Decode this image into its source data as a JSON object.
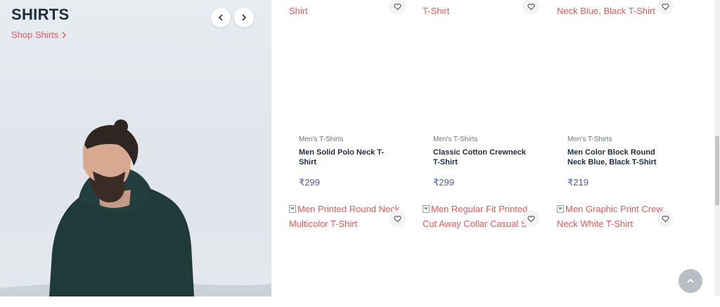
{
  "hero": {
    "title": "SHIRTS",
    "shop_link": "Shop Shirts",
    "prev_icon": "chevron-left-icon",
    "next_icon": "chevron-right-icon"
  },
  "products_top": [
    {
      "image_alt_tail": "Shirt",
      "category": "Men's T-Shirts",
      "name_line1": "Men Solid Polo Neck T-",
      "name_line2": "Shirt",
      "price": "₹299"
    },
    {
      "image_alt_tail": "T-Shirt",
      "category": "Men's T-Shirts",
      "name_line1": "Classic Cotton Crewneck",
      "name_line2": "T-Shirt",
      "price": "₹299"
    },
    {
      "image_alt_tail": "Neck Blue, Black T-Shirt",
      "category": "Men's T-Shirts",
      "name_line1": "Men Color Block Round",
      "name_line2": "Neck Blue, Black T-Shirt",
      "price": "₹219"
    }
  ],
  "products_bottom": [
    {
      "image_alt_line1": "Men Printed Round Neck",
      "image_alt_line2": "Multicolor T-Shirt"
    },
    {
      "image_alt_line1": "Men Regular Fit Printed",
      "image_alt_line2": "Cut Away Collar Casual S"
    },
    {
      "image_alt_line1": "Men Graphic Print Crew",
      "image_alt_line2": "Neck White T-Shirt"
    }
  ],
  "icons": {
    "wishlist": "heart-icon",
    "scroll_top": "chevron-up-icon"
  },
  "colors": {
    "accent": "#f2555a",
    "price": "#4a58b4",
    "title": "#1f2d3d"
  }
}
